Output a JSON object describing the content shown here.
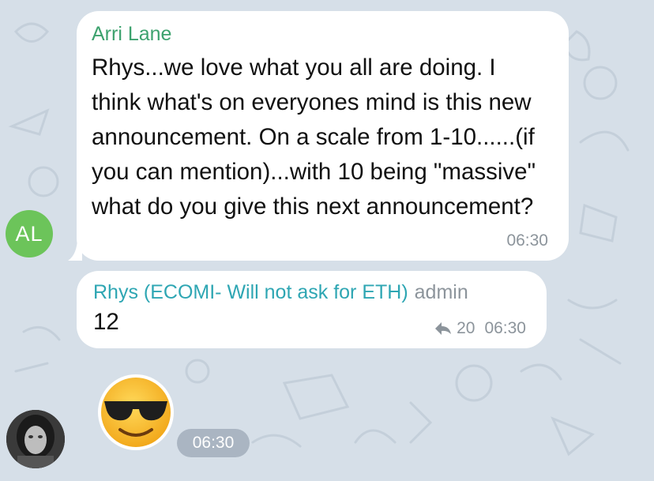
{
  "messages": [
    {
      "sender": "Arri Lane",
      "avatar_initials": "AL",
      "avatar_color": "#6cc45a",
      "sender_color": "#3da26e",
      "text": "Rhys...we love what you all are doing. I think what's on everyones mind is this new announcement. On a scale from 1-10......(if you can mention)...with 10 being \"massive\" what do you give this next announcement?",
      "time": "06:30"
    },
    {
      "sender": "Rhys (ECOMI- Will not ask for ETH)",
      "role": "admin",
      "sender_color": "#2ea6b3",
      "text": "12",
      "reply_count": "20",
      "reply_icon": "reply-arrow-icon",
      "time": "06:30"
    },
    {
      "sender_avatar": "profile-photo",
      "sticker": "sunglasses-emoji",
      "time": "06:30"
    }
  ],
  "background_color": "#d6dfe8"
}
